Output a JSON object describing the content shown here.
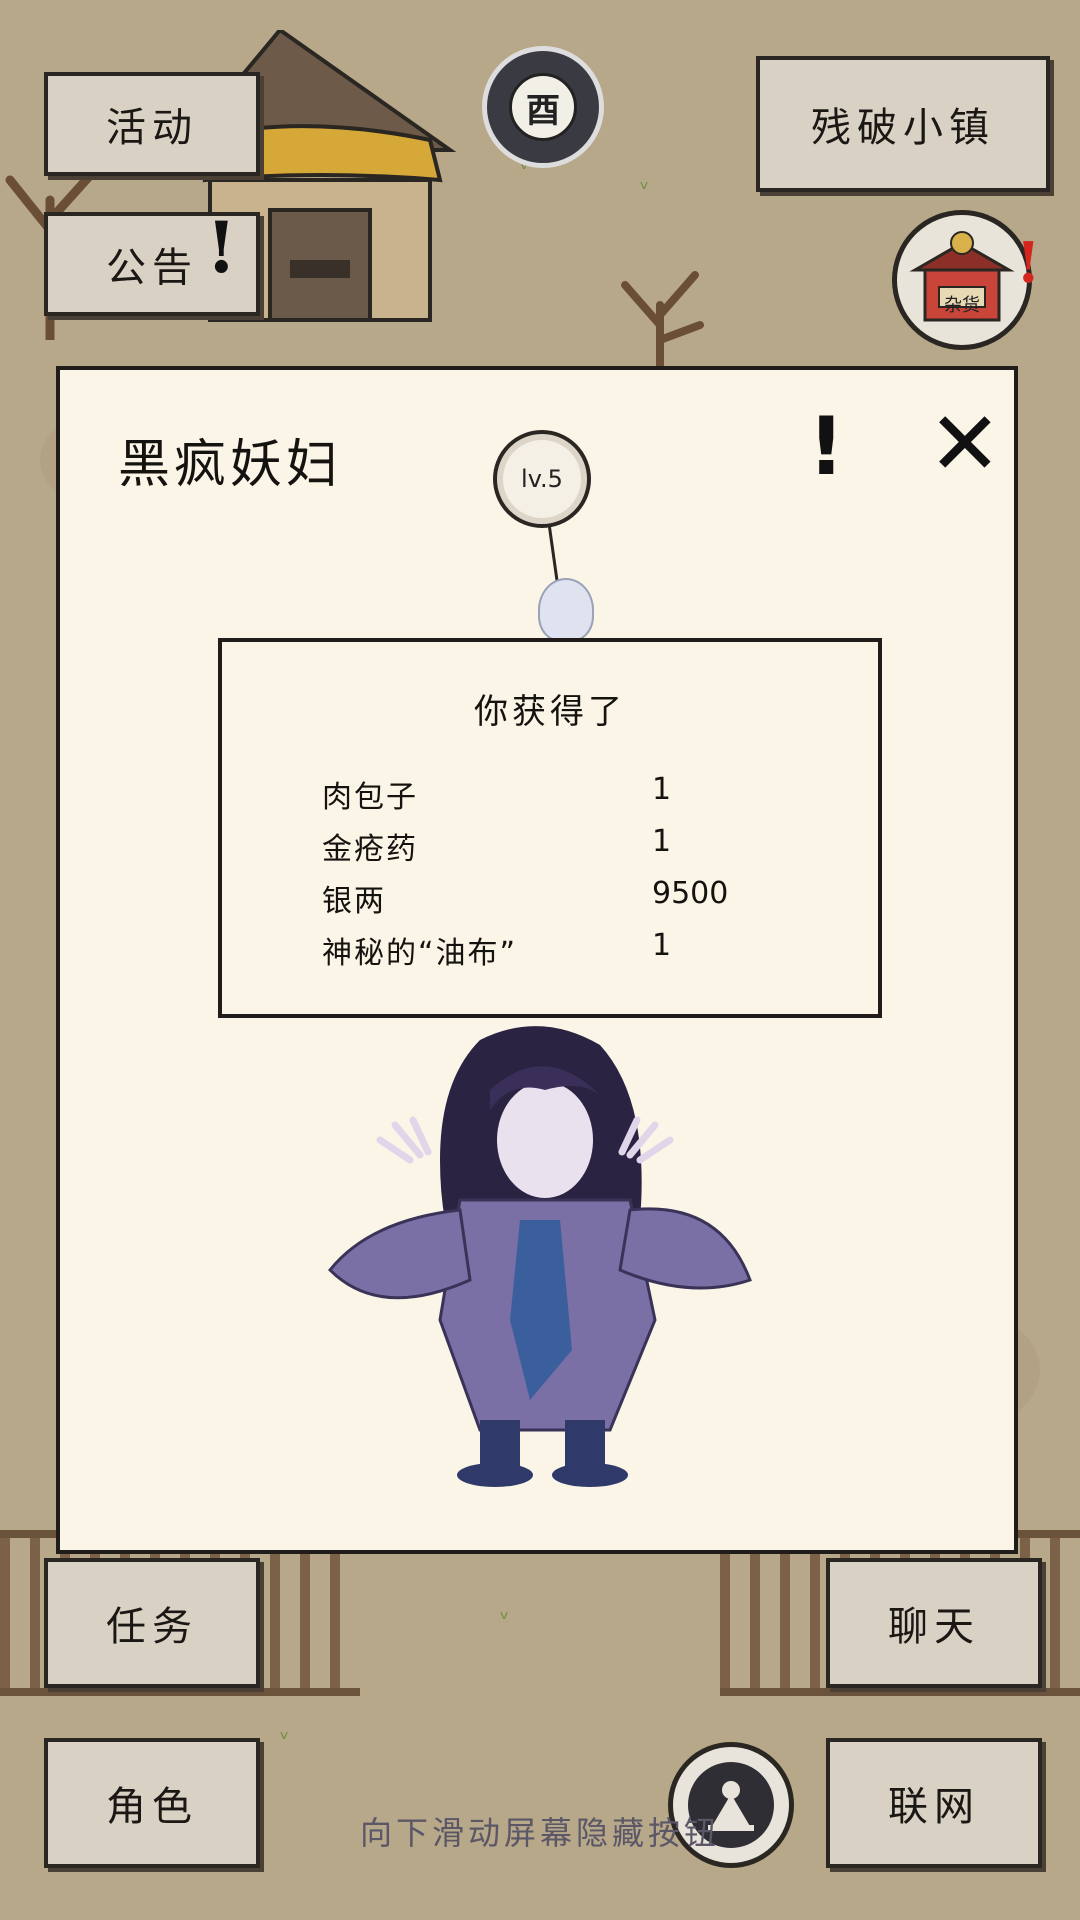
{
  "top_buttons": {
    "activity": "活动",
    "notice": "公告",
    "location": "残破小镇"
  },
  "clock": {
    "time_char": "酉"
  },
  "shop": {
    "label": "杂货"
  },
  "dialog": {
    "title": "黑疯妖妇",
    "level": "lv.5",
    "reward_title": "你获得了",
    "rewards": [
      {
        "name": "肉包子",
        "qty": "1"
      },
      {
        "name": "金疮药",
        "qty": "1"
      },
      {
        "name": "银两",
        "qty": "9500"
      },
      {
        "name": "神秘的“油布”",
        "qty": "1"
      }
    ]
  },
  "bottom_buttons": {
    "task": "任务",
    "character": "角色",
    "chat": "聊天",
    "online": "联网"
  },
  "hint": "向下滑动屏幕隐藏按钮",
  "colors": {
    "ground": "#b8a88a",
    "paper": "#fbf5e8",
    "button": "#d9d2c4",
    "ink": "#1a1714"
  }
}
